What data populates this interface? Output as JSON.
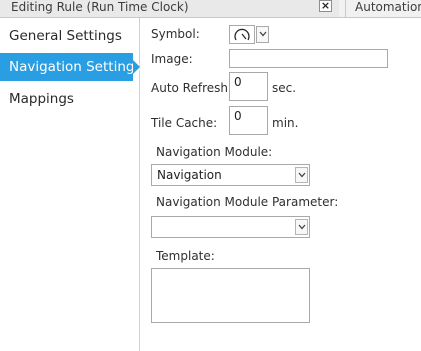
{
  "tabs": {
    "active_title": "Editing Rule (Run Time Clock)",
    "close_label": "×",
    "inactive_title": "Automation"
  },
  "nav": {
    "items": [
      {
        "label": "General Settings",
        "selected": false
      },
      {
        "label": "Navigation Settings",
        "selected": true
      },
      {
        "label": "Mappings",
        "selected": false
      }
    ]
  },
  "form": {
    "symbol_label": "Symbol:",
    "symbol_icon": "clock-gauge-icon",
    "image_label": "Image:",
    "image_value": "",
    "auto_refresh_label": "Auto Refresh:",
    "auto_refresh_value": "0",
    "auto_refresh_unit": "sec.",
    "tile_cache_label": "Tile Cache:",
    "tile_cache_value": "0",
    "tile_cache_unit": "min.",
    "nav_module_label": "Navigation Module:",
    "nav_module_value": "Navigation",
    "nav_module_param_label": "Navigation Module Parameter:",
    "nav_module_param_value": "",
    "template_label": "Template:",
    "template_value": ""
  },
  "colors": {
    "selected_nav": "#2a9ee2",
    "field_border": "#a9a9a9"
  }
}
